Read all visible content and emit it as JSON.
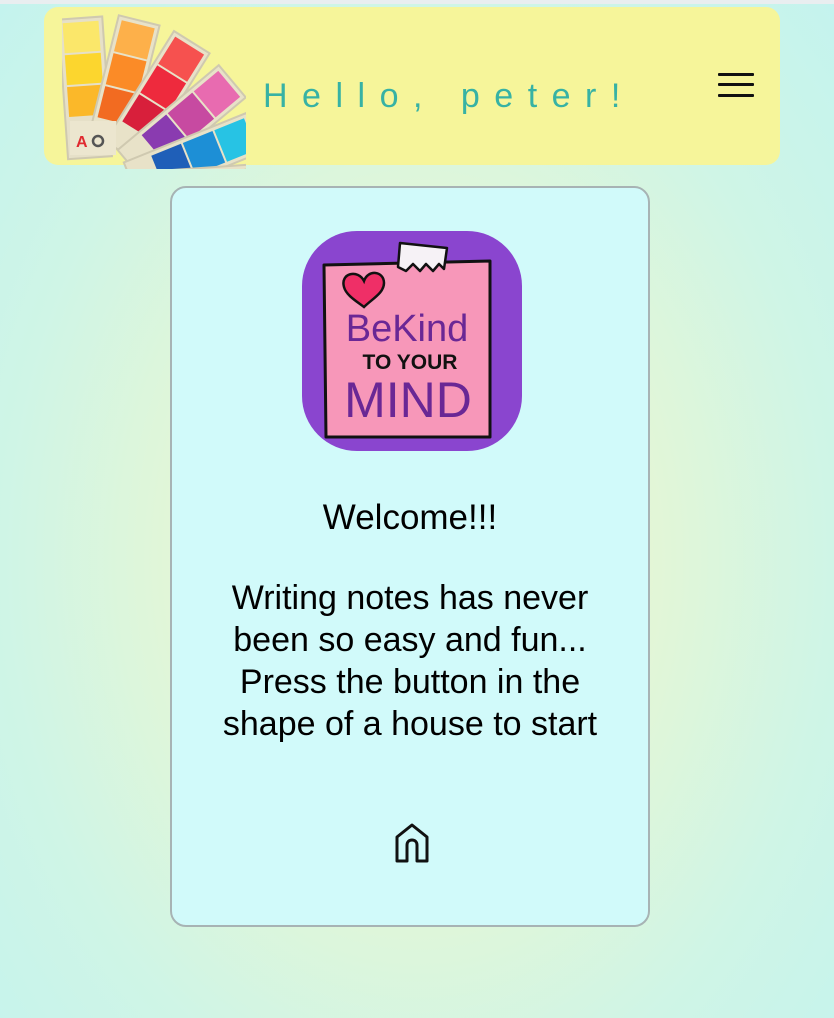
{
  "header": {
    "greeting": "Hello, peter!",
    "menu_icon": "hamburger-menu-icon",
    "logo_icon": "color-swatch-fan-icon",
    "background_color": "#f6f59a",
    "greeting_color": "#37b2a4"
  },
  "card": {
    "sticker": {
      "line1": "BeKind",
      "line2": "TO YOUR",
      "line3": "MIND",
      "background_color": "#8a45cf",
      "note_color": "#f797b9"
    },
    "welcome": "Welcome!!!",
    "message": "Writing notes has never been so easy and fun... Press the button in the shape of a house to start",
    "home_icon": "home-icon",
    "background_color": "#d1fafa"
  }
}
